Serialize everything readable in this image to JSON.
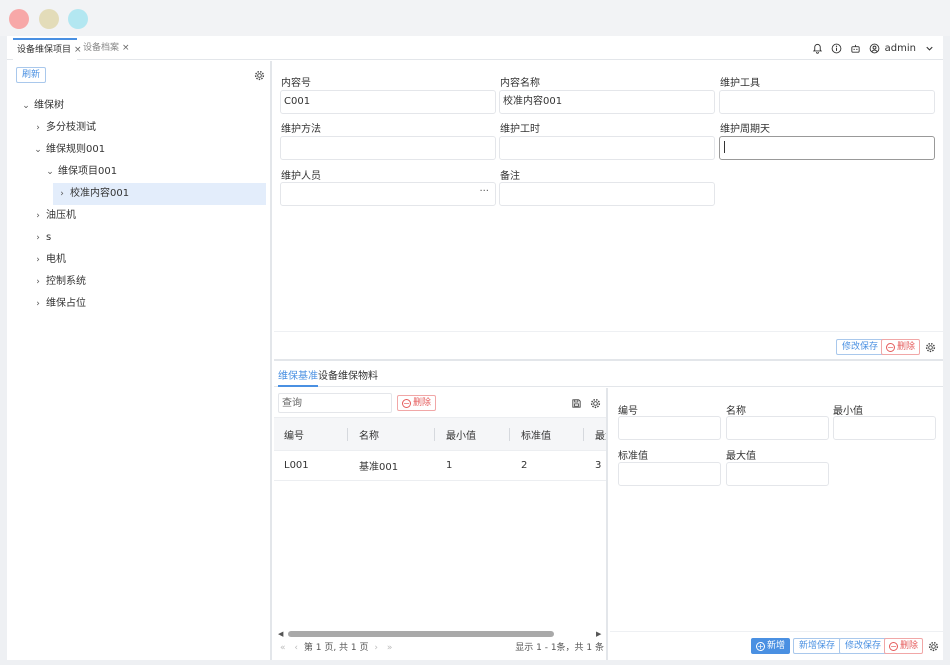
{
  "tabs": [
    {
      "label": "设备维保项目",
      "close": "×"
    },
    {
      "label": "设备档案",
      "close": "×"
    }
  ],
  "header": {
    "username": "admin"
  },
  "left": {
    "refresh_label": "刷新",
    "tree": [
      {
        "label": "维保树",
        "chevron": "⌄"
      },
      {
        "label": "多分枝测试",
        "chevron": "›"
      },
      {
        "label": "维保规则001",
        "chevron": "⌄"
      },
      {
        "label": "维保项目001",
        "chevron": "⌄"
      },
      {
        "label": "校准内容001",
        "chevron": "›"
      },
      {
        "label": "油压机",
        "chevron": "›"
      },
      {
        "label": "s",
        "chevron": "›"
      },
      {
        "label": "电机",
        "chevron": "›"
      },
      {
        "label": "控制系统",
        "chevron": "›"
      },
      {
        "label": "维保占位",
        "chevron": "›"
      }
    ]
  },
  "form": {
    "fields": [
      {
        "label": "内容号",
        "value": "C001"
      },
      {
        "label": "内容名称",
        "value": "校准内容001"
      },
      {
        "label": "维护工具",
        "value": ""
      },
      {
        "label": "维护方法",
        "value": ""
      },
      {
        "label": "维护工时",
        "value": ""
      },
      {
        "label": "维护周期天",
        "value": ""
      },
      {
        "label": "维护人员",
        "value": "",
        "dots": "···"
      },
      {
        "label": "备注",
        "value": ""
      }
    ],
    "save_label": "修改保存",
    "delete_label": "删除"
  },
  "bottom": {
    "tabs": [
      "维保基准",
      "设备维保物料"
    ],
    "search_placeholder": "查询",
    "delete_label": "删除",
    "columns": [
      "编号",
      "名称",
      "最小值",
      "标准值",
      "最大值"
    ],
    "rows": [
      [
        "L001",
        "基准001",
        "1",
        "2",
        "3"
      ]
    ],
    "pager": {
      "first": "«",
      "prev": "‹",
      "text": "第 1 页, 共 1 页",
      "next": "›",
      "last": "»"
    },
    "page_info": "显示 1 - 1条，共 1 条",
    "detail_fields": [
      {
        "label": "编号",
        "value": ""
      },
      {
        "label": "名称",
        "value": ""
      },
      {
        "label": "最小值",
        "value": ""
      },
      {
        "label": "标准值",
        "value": ""
      },
      {
        "label": "最大值",
        "value": ""
      }
    ],
    "new_label": "新增",
    "new_save_label": "新增保存",
    "edit_save_label": "修改保存",
    "detail_delete_label": "删除"
  },
  "colors": {
    "accent": "#4a90e2",
    "danger": "#e55c5c",
    "selected_row": "#e3edfb"
  }
}
